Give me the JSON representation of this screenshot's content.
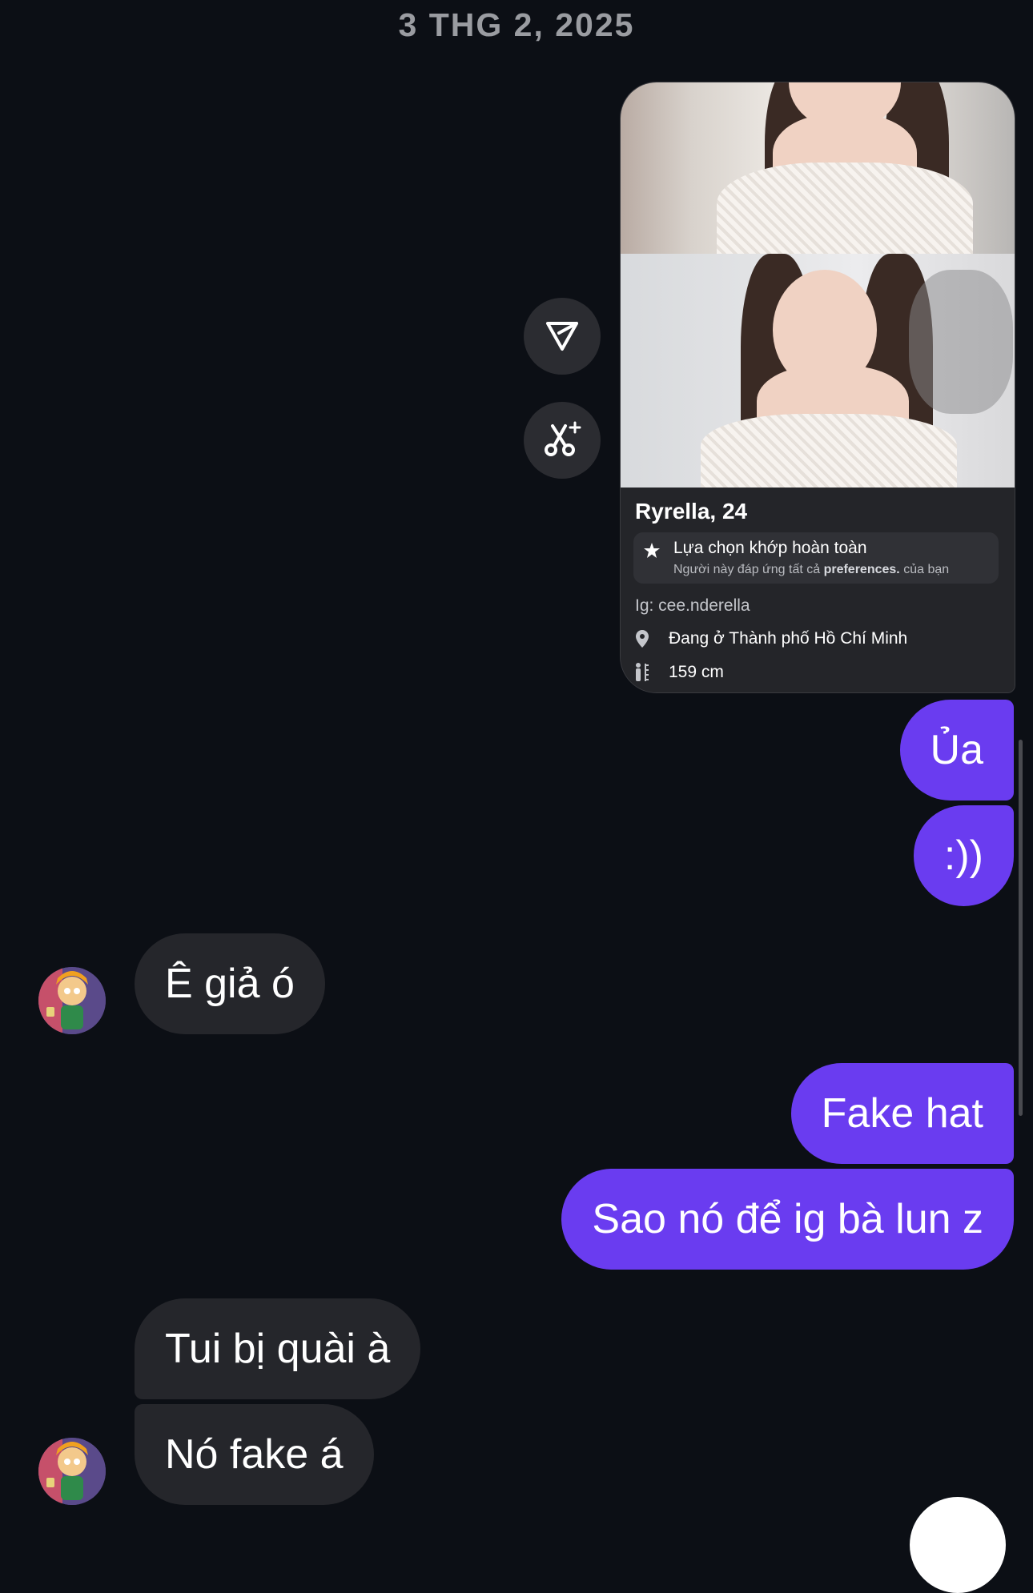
{
  "date_header": "3 THG 2, 2025",
  "profile_card": {
    "name": "Ryrella, 24",
    "match_title": "Lựa chọn khớp hoàn toàn",
    "match_sub_pre": "Người này đáp ứng tất cả ",
    "match_sub_bold": "preferences.",
    "match_sub_post": " của bạn",
    "ig": "Ig: cee.nderella",
    "location": "Đang ở Thành phố Hồ Chí Minh",
    "height": "159 cm"
  },
  "actions": {
    "icons": [
      "send-icon",
      "ai-scissors-icon"
    ]
  },
  "messages": [
    {
      "side": "out",
      "text": "Ủa"
    },
    {
      "side": "out",
      "text": ":))"
    },
    {
      "side": "in",
      "text": "Ê giả ó"
    },
    {
      "side": "out",
      "text": "Fake hat"
    },
    {
      "side": "out",
      "text": "Sao nó để ig bà lun z"
    },
    {
      "side": "in",
      "text": "Tui bị quài à"
    },
    {
      "side": "in",
      "text": "Nó fake á"
    }
  ],
  "colors": {
    "background": "#0c0f15",
    "outgoing_bubble": "#6a3cf0",
    "incoming_bubble": "#25262b",
    "card": "#242529"
  }
}
